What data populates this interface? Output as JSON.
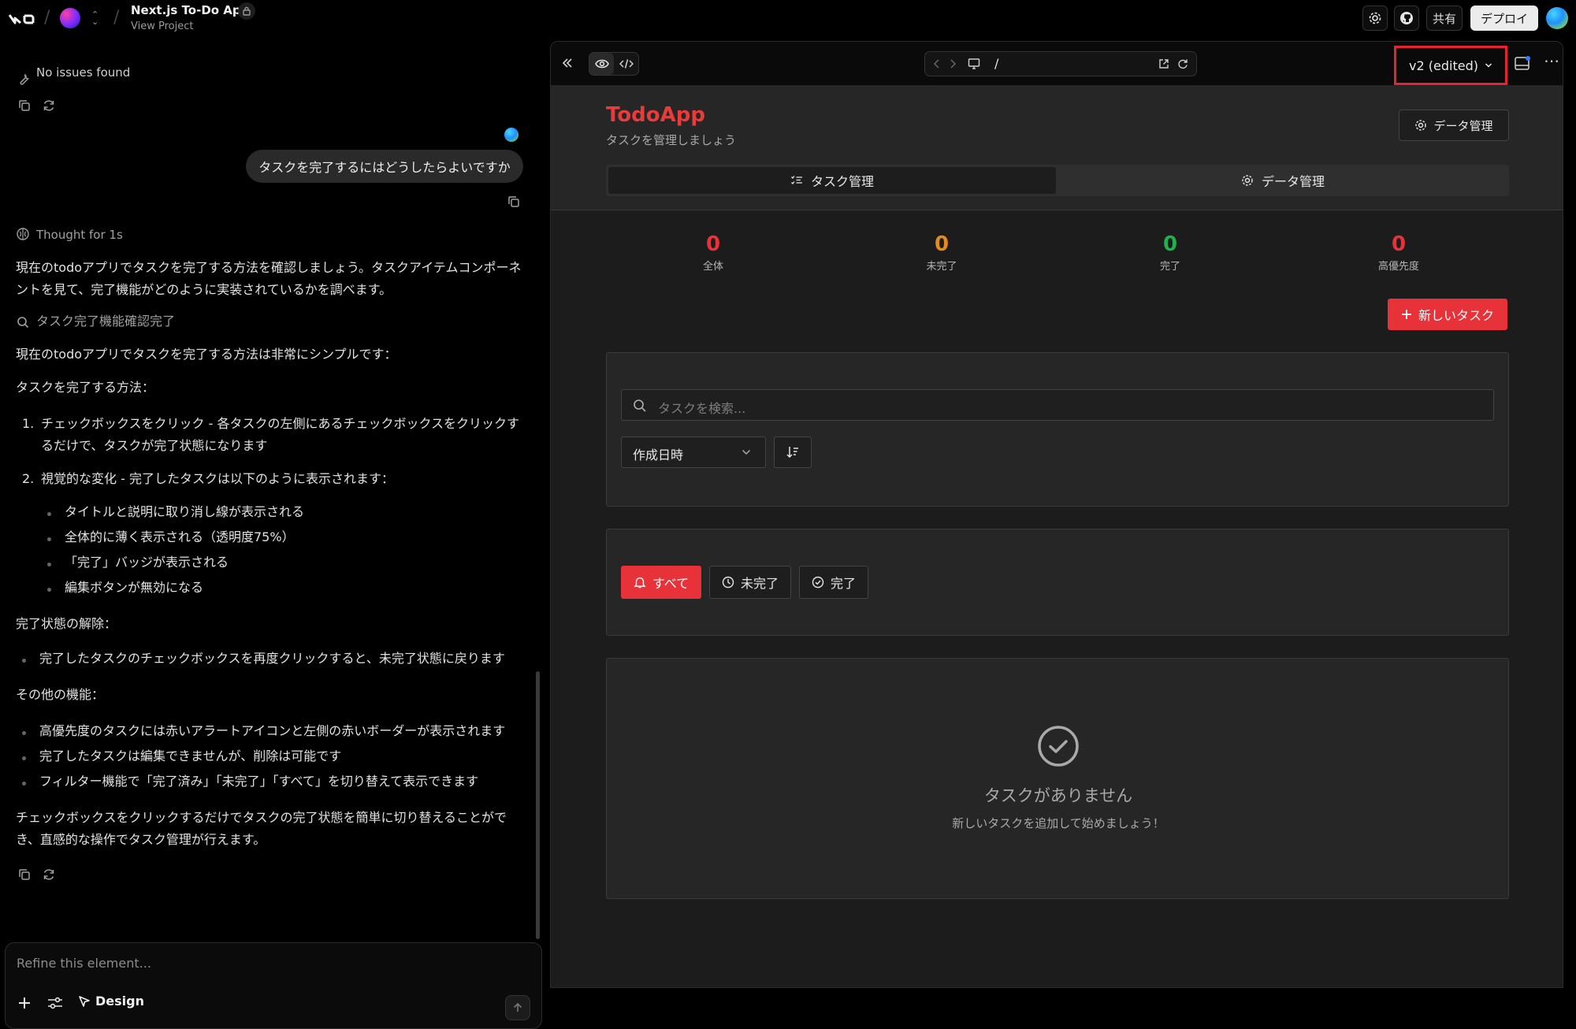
{
  "header": {
    "project_title": "Next.js To-Do App",
    "project_link": "View Project",
    "share_label": "共有",
    "deploy_label": "デプロイ"
  },
  "chat": {
    "status": "No issues found",
    "user_message": "タスクを完了するにはどうしたらよいですか",
    "thought": "Thought for 1s",
    "intro_line1": "現在のtodoアプリでタスクを完了する方法を確認しましょう。タスクアイテムコンポーネ",
    "intro_line2": "ントを見て、完了機能がどのように実装されているかを調べます。",
    "search_step": "タスク完了機能確認完了",
    "answer_intro": "現在のtodoアプリでタスクを完了する方法は非常にシンプルです：",
    "how_heading": "タスクを完了する方法：",
    "step1_line1": "チェックボックスをクリック - 各タスクの左側にあるチェックボックスをクリックす",
    "step1_line2": "るだけで、タスクが完了状態になります",
    "step2": "視覚的な変化 - 完了したタスクは以下のように表示されます：",
    "visual_changes": [
      "タイトルと説明に取り消し線が表示される",
      "全体的に薄く表示される（透明度75%）",
      "「完了」バッジが表示される",
      "編集ボタンが無効になる"
    ],
    "undo_heading": "完了状態の解除：",
    "undo_item": "完了したタスクのチェックボックスを再度クリックすると、未完了状態に戻ります",
    "other_heading": "その他の機能：",
    "other_items": [
      "高優先度のタスクには赤いアラートアイコンと左側の赤いボーダーが表示されます",
      "完了したタスクは編集できませんが、削除は可能です",
      "フィルター機能で「完了済み」「未完了」「すべて」を切り替えて表示できます"
    ],
    "conclusion_line1": "チェックボックスをクリックするだけでタスクの完了状態を簡単に切り替えることがで",
    "conclusion_line2": "き、直感的な操作でタスク管理が行えます。",
    "composer_placeholder": "Refine this element...",
    "design_label": "Design"
  },
  "preview": {
    "url_path": "/",
    "version_label": "v2 (edited)"
  },
  "app": {
    "title": "TodoApp",
    "subtitle": "タスクを管理しましょう",
    "data_button": "データ管理",
    "tabs": [
      {
        "label": "タスク管理"
      },
      {
        "label": "データ管理"
      }
    ],
    "stats": [
      {
        "value": "0",
        "label": "全体",
        "color": "#e8323a"
      },
      {
        "value": "0",
        "label": "未完了",
        "color": "#e38b1e"
      },
      {
        "value": "0",
        "label": "完了",
        "color": "#1fb24a"
      },
      {
        "value": "0",
        "label": "高優先度",
        "color": "#e8323a"
      }
    ],
    "new_task_button": "新しいタスク",
    "search_placeholder": "タスクを検索...",
    "sort_select": "作成日時",
    "filters": [
      {
        "label": "すべて"
      },
      {
        "label": "未完了"
      },
      {
        "label": "完了"
      }
    ],
    "empty_title": "タスクがありません",
    "empty_subtitle": "新しいタスクを追加して始めましょう！"
  },
  "colors": {
    "accent_red": "#e8323a",
    "highlight_border": "#e8232f"
  }
}
